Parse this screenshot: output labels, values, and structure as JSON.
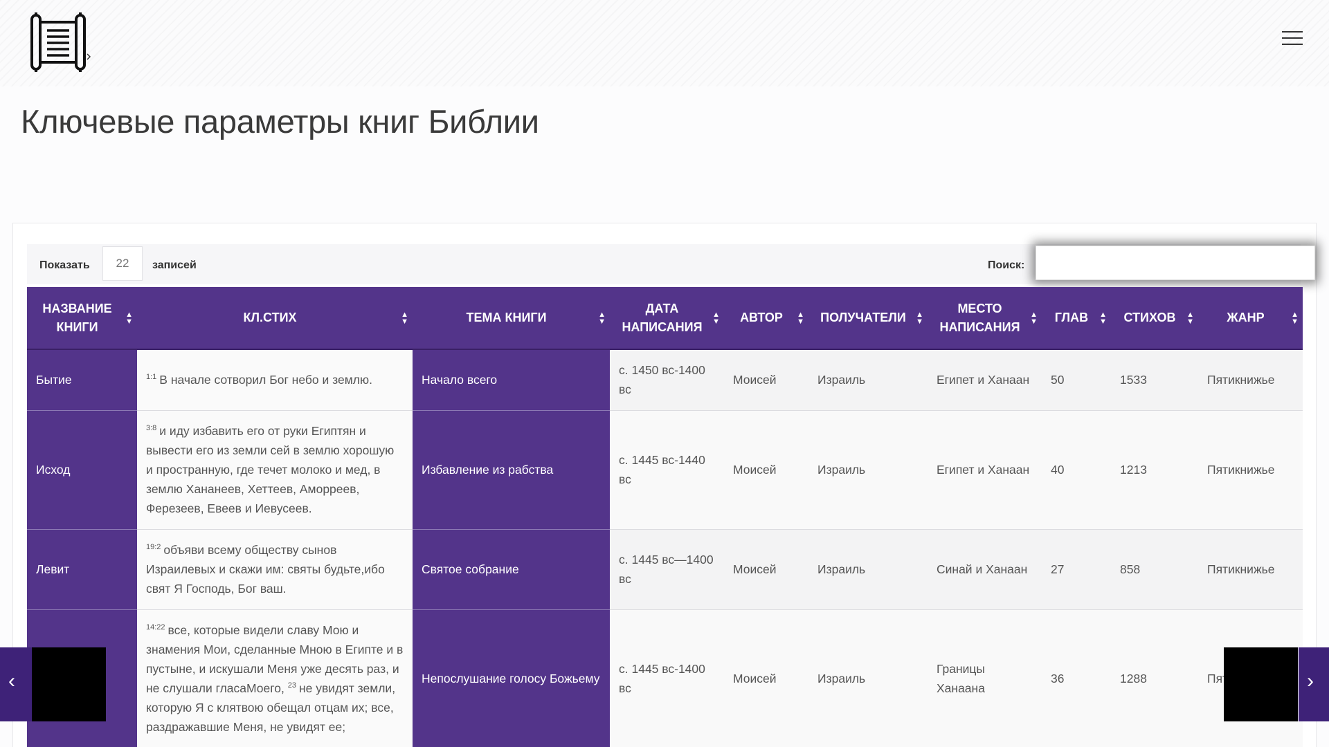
{
  "page": {
    "title": "Ключевые параметры книг Библии"
  },
  "icons": {
    "logo": "scroll-icon",
    "menu": "hamburger-icon",
    "sort": "sort-icon",
    "prev": "chevron-left-icon",
    "next": "chevron-right-icon"
  },
  "colors": {
    "accent": "#53348a",
    "accent_dark": "#3e2278"
  },
  "controls": {
    "show_label": "Показать",
    "show_value": "22",
    "records_label": "записей",
    "search_label": "Поиск:",
    "search_value": ""
  },
  "table": {
    "columns": [
      "НАЗВАНИЕ КНИГИ",
      "КЛ.СТИХ",
      "ТЕМА КНИГИ",
      "ДАТА НАПИСАНИЯ",
      "АВТОР",
      "ПОЛУЧАТЕЛИ",
      "МЕСТО НАПИСАНИЯ",
      "ГЛАВ",
      "СТИХОВ",
      "ЖАНР"
    ],
    "rows": [
      {
        "name": "Бытие",
        "verse_ref": "1:1",
        "verse": "В начале сотворил Бог небо и землю.",
        "theme": "Начало всего",
        "date": "с. 1450 вс-1400 вс",
        "author": "Моисей",
        "recipients": "Израиль",
        "place": "Египет и Ханаан",
        "chapters": "50",
        "verses": "1533",
        "genre": "Пятикнижье"
      },
      {
        "name": "Исход",
        "verse_ref": "3:8",
        "verse": "и иду избавить его от руки Египтян и вывести его из земли сей в землю хорошую и пространную, где течет молоко и мед, в землю Хананеев, Хеттеев, Аморреев, Ферезеев, Евеев и Иевусеев.",
        "theme": "Избавление из рабства",
        "date": "с. 1445 вс-1440 вс",
        "author": "Моисей",
        "recipients": "Израиль",
        "place": "Египет и Ханаан",
        "chapters": "40",
        "verses": "1213",
        "genre": "Пятикнижье"
      },
      {
        "name": "Левит",
        "verse_ref": "19:2",
        "verse": "объяви всему обществу сынов Израилевых и скажи им: святы будьте,ибо свят Я Господь, Бог ваш.",
        "theme": "Святое собрание",
        "date": "с. 1445 вс—1400 вс",
        "author": "Моисей",
        "recipients": "Израиль",
        "place": "Синай и Ханаан",
        "chapters": "27",
        "verses": "858",
        "genre": "Пятикнижье"
      },
      {
        "name": "",
        "verse_ref": "14:22",
        "verse_a": "все, которые видели славу Мою и знамения Мои, сделанные Мною в Египте и в пустыне, и искушали Меня уже десять раз, и не слушали гласаМоего,",
        "verse_ref2": "23",
        "verse_b": "не увидят земли, которую Я с клятвою обещал отцам их; все, раздражавшие Меня, не увидят ее;",
        "theme": "Непослушание голосу Божьему",
        "date": "с. 1445 вс-1400 вс",
        "author": "Моисей",
        "recipients": "Израиль",
        "place": "Границы Ханаана",
        "chapters": "36",
        "verses": "1288",
        "genre": "Пят"
      }
    ]
  }
}
